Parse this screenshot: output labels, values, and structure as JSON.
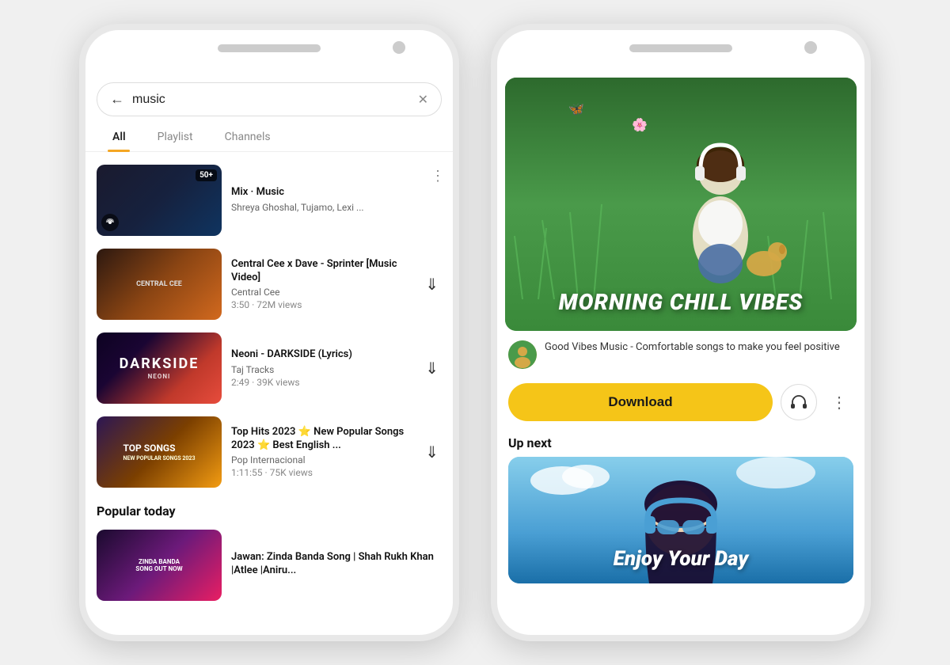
{
  "left_phone": {
    "search": {
      "query": "music",
      "placeholder": "Search"
    },
    "tabs": [
      {
        "label": "All",
        "active": true
      },
      {
        "label": "Playlist",
        "active": false
      },
      {
        "label": "Channels",
        "active": false
      }
    ],
    "videos": [
      {
        "id": "mix",
        "thumb_type": "mix",
        "badge": "50+",
        "title": "Mix · Music",
        "channel": "Shreya Ghoshal, Tujamo, Lexi ...",
        "meta": "",
        "has_radio": true,
        "has_more": true,
        "has_download": false
      },
      {
        "id": "central",
        "thumb_type": "cee",
        "badge": "",
        "title": "Central Cee x Dave - Sprinter [Music Video]",
        "channel": "Central Cee",
        "meta": "3:50 · 72M views",
        "has_radio": false,
        "has_more": false,
        "has_download": true
      },
      {
        "id": "darkside",
        "thumb_type": "dark",
        "badge": "",
        "title": "Neoni - DARKSIDE (Lyrics)",
        "channel": "Taj Tracks",
        "meta": "2:49 · 39K views",
        "has_radio": false,
        "has_more": false,
        "has_download": true
      },
      {
        "id": "tophits",
        "thumb_type": "top",
        "badge": "",
        "title": "Top Hits 2023 ⭐ New Popular Songs 2023 ⭐ Best English ...",
        "channel": "Pop Internacional",
        "meta": "1:11:55 · 75K views",
        "has_radio": false,
        "has_more": false,
        "has_download": true
      }
    ],
    "popular_today": {
      "label": "Popular today"
    },
    "popular_videos": [
      {
        "id": "zinda",
        "thumb_type": "zinda",
        "title": "Jawan: Zinda Banda Song | Shah Rukh Khan |Atlee |Aniru...",
        "channel": "",
        "meta": ""
      }
    ]
  },
  "right_phone": {
    "hero_title": "Morning Chill Vibes",
    "channel_desc": "Good Vibes Music - Comfortable songs to make you feel positive",
    "download_label": "Download",
    "up_next_label": "Up next",
    "next_title": "Enjoy Your Day"
  }
}
